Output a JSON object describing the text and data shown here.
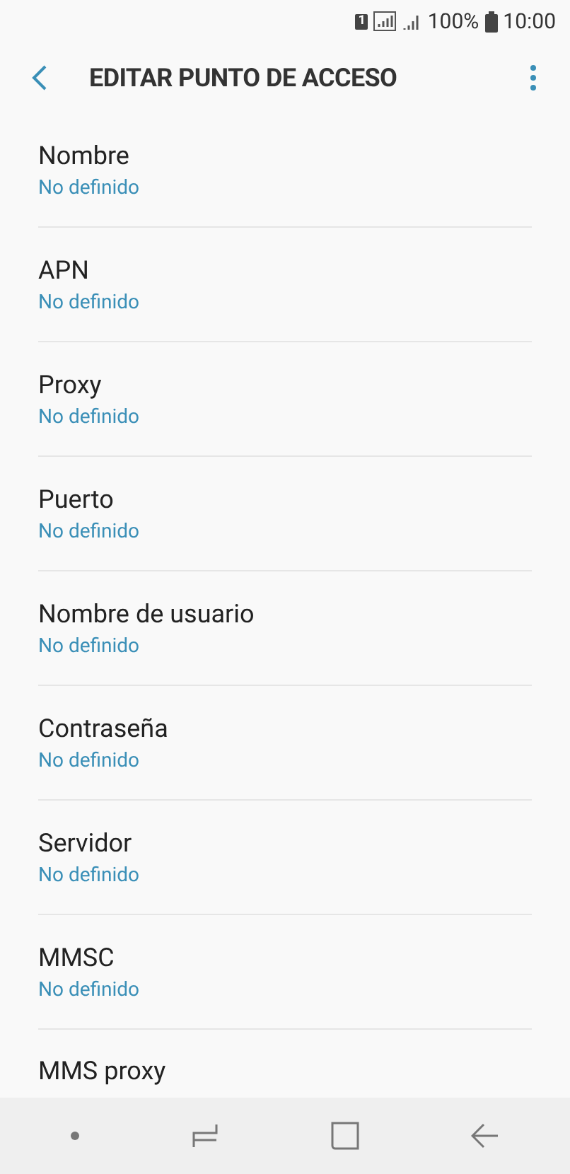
{
  "status_bar": {
    "sim": "1",
    "battery_percent": "100%",
    "time": "10:00"
  },
  "header": {
    "title": "EDITAR PUNTO DE ACCESO"
  },
  "settings": [
    {
      "label": "Nombre",
      "value": "No definido"
    },
    {
      "label": "APN",
      "value": "No definido"
    },
    {
      "label": "Proxy",
      "value": "No definido"
    },
    {
      "label": "Puerto",
      "value": "No definido"
    },
    {
      "label": "Nombre de usuario",
      "value": "No definido"
    },
    {
      "label": "Contraseña",
      "value": "No definido"
    },
    {
      "label": "Servidor",
      "value": "No definido"
    },
    {
      "label": "MMSC",
      "value": "No definido"
    },
    {
      "label": "MMS proxy"
    }
  ]
}
